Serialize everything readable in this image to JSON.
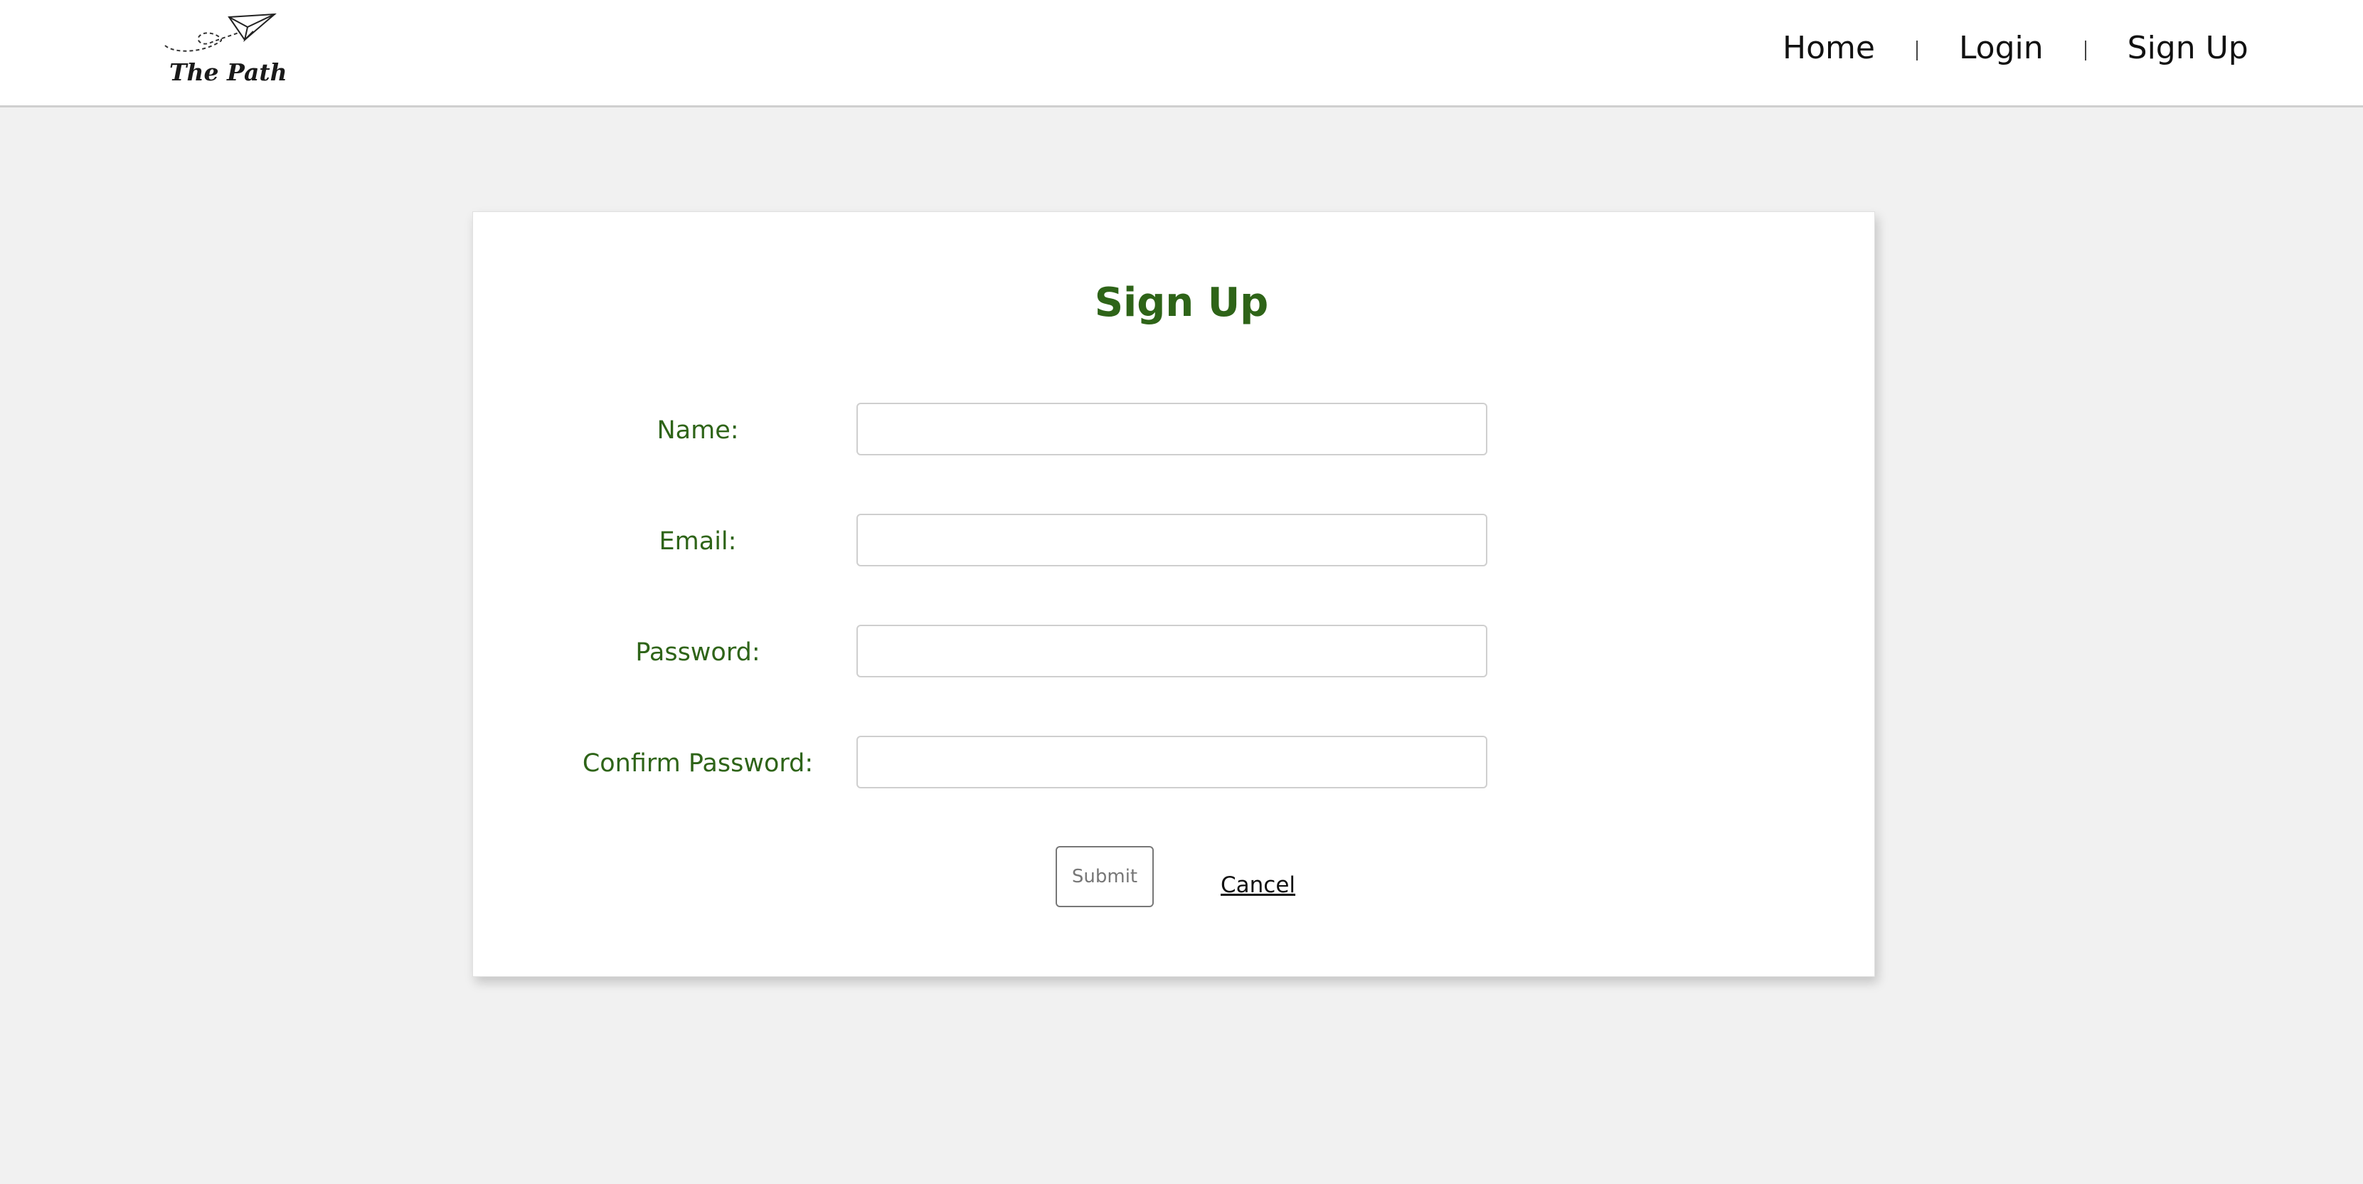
{
  "logo": {
    "text": "The Path",
    "icon": "paper-plane-icon"
  },
  "nav": {
    "items": [
      {
        "label": "Home"
      },
      {
        "label": "Login"
      },
      {
        "label": "Sign Up"
      }
    ],
    "separator": "|"
  },
  "form": {
    "title": "Sign Up",
    "fields": [
      {
        "label": "Name:",
        "value": "",
        "placeholder": ""
      },
      {
        "label": "Email:",
        "value": "",
        "placeholder": ""
      },
      {
        "label": "Password:",
        "value": "",
        "placeholder": ""
      },
      {
        "label": "Confirm Password:",
        "value": "",
        "placeholder": ""
      }
    ],
    "submit_label": "Submit",
    "cancel_label": "Cancel"
  },
  "colors": {
    "accent": "#2e6418",
    "background": "#f1f1f1",
    "card": "#ffffff"
  }
}
